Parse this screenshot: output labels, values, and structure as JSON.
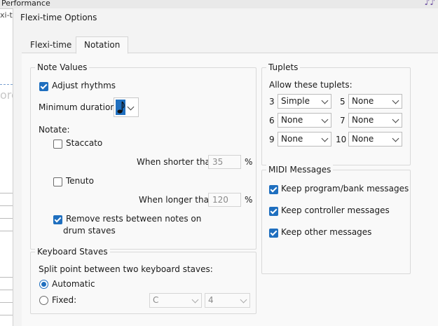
{
  "background": {
    "title": "Performance",
    "title2": "xi-t",
    "partial_text": "ore"
  },
  "dialog": {
    "title": "Flexi-time Options",
    "tabs": [
      {
        "label": "Flexi-time",
        "active": false
      },
      {
        "label": "Notation",
        "active": true
      }
    ],
    "note_values": {
      "legend": "Note Values",
      "adjust_rhythms": {
        "label": "Adjust rhythms",
        "checked": true
      },
      "minimum_duration_label": "Minimum duration:",
      "minimum_duration_icon": "eighth-note-icon",
      "notate_label": "Notate:",
      "staccato": {
        "label": "Staccato",
        "checked": false
      },
      "when_shorter_label": "When shorter than:",
      "when_shorter_value": "35",
      "percent1": "%",
      "tenuto": {
        "label": "Tenuto",
        "checked": false
      },
      "when_longer_label": "When longer than:",
      "when_longer_value": "120",
      "percent2": "%",
      "remove_rests": {
        "label_line1": "Remove rests between notes on",
        "label_line2": "drum staves",
        "checked": true
      }
    },
    "keyboard_staves": {
      "legend": "Keyboard Staves",
      "split_label": "Split point between two keyboard staves:",
      "automatic": {
        "label": "Automatic",
        "selected": true
      },
      "fixed": {
        "label": "Fixed:",
        "selected": false
      },
      "note_select": "C",
      "octave_select": "4"
    },
    "tuplets": {
      "legend": "Tuplets",
      "allow_label": "Allow these tuplets:",
      "rows": [
        {
          "n": "3",
          "value": "Simple"
        },
        {
          "n": "5",
          "value": "None"
        },
        {
          "n": "6",
          "value": "None"
        },
        {
          "n": "7",
          "value": "None"
        },
        {
          "n": "9",
          "value": "None"
        },
        {
          "n": "10",
          "value": "None"
        }
      ]
    },
    "midi": {
      "legend": "MIDI Messages",
      "items": [
        {
          "label": "Keep program/bank messages",
          "checked": true
        },
        {
          "label": "Keep controller messages",
          "checked": true
        },
        {
          "label": "Keep other messages",
          "checked": true
        }
      ]
    }
  },
  "colors": {
    "accent": "#1f6fbf"
  }
}
